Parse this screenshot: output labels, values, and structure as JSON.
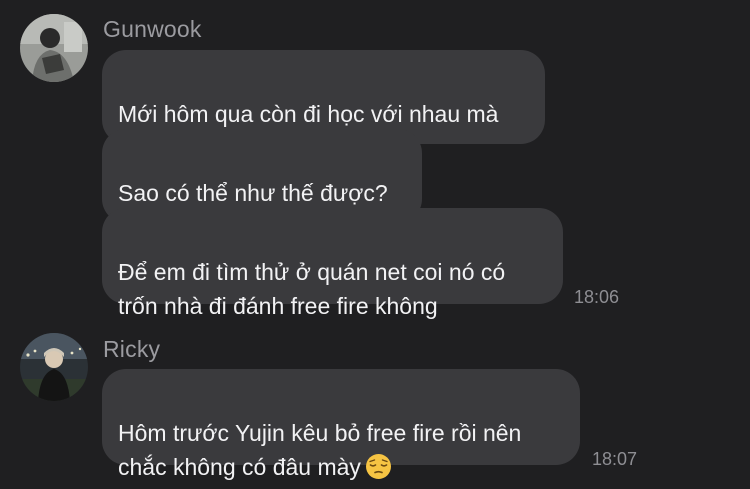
{
  "messages": [
    {
      "sender": "Gunwook",
      "bubbles": [
        "Mới hôm qua còn đi học với nhau mà",
        "Sao có thể như thế được?",
        "Để em đi tìm thử ở quán net coi nó có\ntrốn nhà đi đánh free fire không"
      ],
      "time": "18:06"
    },
    {
      "sender": "Ricky",
      "bubbles": [
        "Hôm trước Yujin kêu bỏ free fire rồi nên\nchắc không có đâu mày"
      ],
      "emoji": "pensive-face-emoji",
      "time": "18:07"
    }
  ],
  "colors": {
    "background": "#1f1f21",
    "bubble": "#3a3a3d",
    "text": "#f2f2f4",
    "secondary": "#9b9ba0"
  }
}
